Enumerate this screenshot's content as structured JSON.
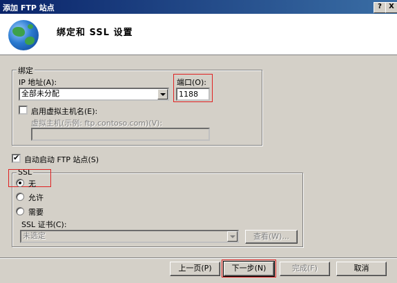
{
  "window": {
    "title": "添加 FTP 站点",
    "help_btn": "?",
    "close_btn": "X"
  },
  "header": {
    "title": "绑定和 SSL 设置"
  },
  "binding": {
    "legend": "绑定",
    "ip_label": "IP 地址(A):",
    "ip_value": "全部未分配",
    "port_label": "端口(O):",
    "port_value": "1188",
    "vhost_checkbox_label": "启用虚拟主机名(E):",
    "vhost_checked": false,
    "vhost_field_label": "虚拟主机(示例: ftp.contoso.com)(V):",
    "vhost_value": ""
  },
  "autostart": {
    "label": "自动启动 FTP 站点(S)",
    "checked": true
  },
  "ssl": {
    "legend": "SSL",
    "options": [
      {
        "label": "无",
        "selected": true
      },
      {
        "label": "允许",
        "selected": false
      },
      {
        "label": "需要",
        "selected": false
      }
    ],
    "cert_label": "SSL 证书(C):",
    "cert_value": "未选定",
    "view_button": "查看(W)..."
  },
  "footer": {
    "prev": "上一页(P)",
    "next": "下一步(N)",
    "finish": "完成(F)",
    "cancel": "取消"
  },
  "colors": {
    "titlebar": "#0a246a",
    "highlight": "#e02020",
    "face": "#d4d0c8"
  }
}
